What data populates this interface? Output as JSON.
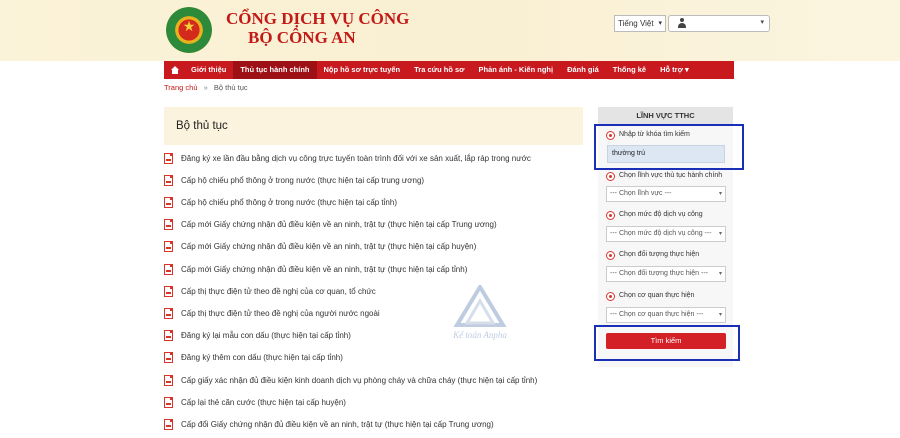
{
  "header": {
    "title_line1": "CỔNG DỊCH VỤ CÔNG",
    "title_line2": "BỘ CÔNG AN",
    "language": "Tiếng Việt",
    "logo_icon": "police-emblem-logo",
    "user_icon": "user-icon"
  },
  "nav": {
    "home_icon": "home-icon",
    "items": [
      {
        "label": "Giới thiệu"
      },
      {
        "label": "Thủ tục hành chính"
      },
      {
        "label": "Nộp hồ sơ trực tuyến"
      },
      {
        "label": "Tra cứu hồ sơ"
      },
      {
        "label": "Phản ánh - Kiến nghị"
      },
      {
        "label": "Đánh giá"
      },
      {
        "label": "Thống kê"
      },
      {
        "label": "Hỗ trợ ▾"
      }
    ],
    "active_index": 1
  },
  "breadcrumb": {
    "home": "Trang chủ",
    "separator": "»",
    "current": "Bộ thủ tục"
  },
  "main": {
    "title": "Bộ thủ tục",
    "items": [
      {
        "label": "Đăng ký xe lần đầu bằng dịch vụ công trực tuyến toàn trình đối với xe sản xuất, lắp ráp trong nước"
      },
      {
        "label": "Cấp hộ chiếu phổ thông ở trong nước (thực hiện tại cấp trung ương)"
      },
      {
        "label": "Cấp hộ chiếu phổ thông ở trong nước (thực hiện tại cấp tỉnh)"
      },
      {
        "label": "Cấp mới Giấy chứng nhận đủ điều kiện về an ninh, trật tự (thực hiện tại cấp Trung ương)"
      },
      {
        "label": "Cấp mới Giấy chứng nhận đủ điều kiện về an ninh, trật tự (thực hiện tại cấp huyện)"
      },
      {
        "label": "Cấp mới Giấy chứng nhận đủ điều kiện về an ninh, trật tự (thực hiện tại cấp tỉnh)"
      },
      {
        "label": "Cấp thị thực điện tử theo đề nghị của cơ quan, tổ chức"
      },
      {
        "label": "Cấp thị thực điện tử theo đề nghị của người nước ngoài"
      },
      {
        "label": "Đăng ký lại mẫu con dấu (thực hiện tại cấp tỉnh)"
      },
      {
        "label": "Đăng ký thêm con dấu (thực hiện tại cấp tỉnh)"
      },
      {
        "label": "Cấp giấy xác nhận đủ điều kiện kinh doanh dịch vụ phòng cháy và chữa cháy (thực hiện tại cấp tỉnh)"
      },
      {
        "label": "Cấp lại thẻ căn cước (thực hiện tại cấp huyện)"
      },
      {
        "label": "Cấp đổi Giấy chứng nhận đủ điều kiện về an ninh, trật tự (thực hiện tại cấp Trung ương)"
      }
    ]
  },
  "watermark": {
    "text": "Kế toán Anpha"
  },
  "sidebar": {
    "title": "LĨNH VỰC TTHC",
    "keyword_label": "Nhập từ khóa tìm kiếm",
    "keyword_value": "thường trú",
    "filters": [
      {
        "label": "Chọn lĩnh vực thủ tục hành chính",
        "selected": "--- Chọn lĩnh vực ---"
      },
      {
        "label": "Chọn mức độ dịch vụ công",
        "selected": "--- Chọn mức độ dịch vụ công ---"
      },
      {
        "label": "Chọn đối tượng thực hiện",
        "selected": "--- Chọn đối tượng thực hiện ---"
      },
      {
        "label": "Chọn cơ quan thực hiện",
        "selected": "--- Chọn cơ quan thực hiện ---"
      }
    ],
    "search_button": "Tìm kiếm"
  },
  "colors": {
    "brand_red": "#c8191f",
    "header_bg": "#fbf3d9",
    "highlight_border": "#1a2fb8"
  }
}
